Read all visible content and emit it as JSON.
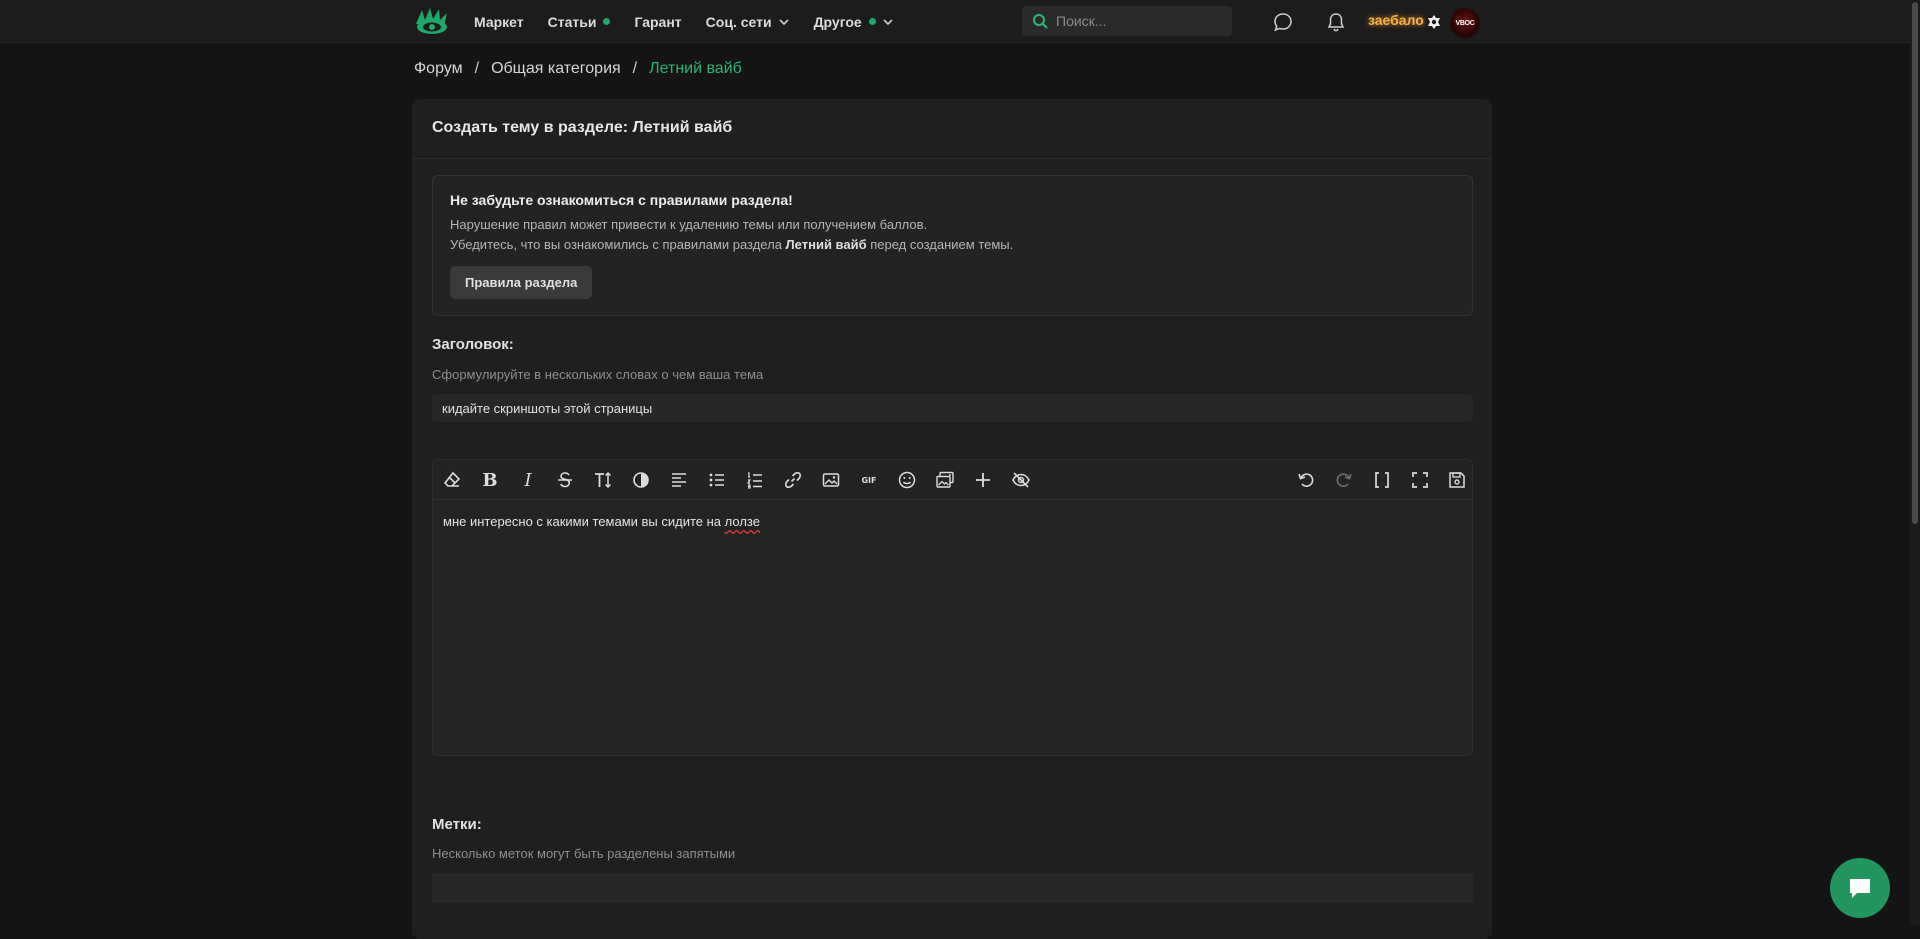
{
  "nav": {
    "items": [
      {
        "label": "Маркет",
        "dot": false,
        "chevron": false
      },
      {
        "label": "Статьи",
        "dot": true,
        "chevron": false
      },
      {
        "label": "Гарант",
        "dot": false,
        "chevron": false
      },
      {
        "label": "Соц. сети",
        "dot": false,
        "chevron": true
      },
      {
        "label": "Другое",
        "dot": true,
        "chevron": true
      }
    ],
    "search_placeholder": "Поиск...",
    "user": {
      "nickname": "заебало",
      "avatar_text": "VBOC"
    }
  },
  "breadcrumb": {
    "items": [
      "Форум",
      "Общая категория",
      "Летний вайб"
    ],
    "separator": "/"
  },
  "panel": {
    "title": "Создать тему в разделе: Летний вайб",
    "notice": {
      "title": "Не забудьте ознакомиться с правилами раздела!",
      "line1": "Нарушение правил может привести к удалению темы или получением баллов.",
      "line2_prefix": "Убедитесь, что вы ознакомились с правилами раздела ",
      "line2_bold": "Летний вайб",
      "line2_suffix": " перед созданием темы.",
      "button": "Правила раздела"
    },
    "title_field": {
      "label": "Заголовок:",
      "hint": "Сформулируйте в нескольких словах о чем ваша тема",
      "value": "кидайте скриншоты этой страницы"
    },
    "editor": {
      "text_before": "мне интересно с какими темами вы сидите на ",
      "text_misspelled": "лолзе",
      "toolbar_left": [
        "eraser-icon",
        "bold-icon",
        "italic-icon",
        "strikethrough-icon",
        "text-size-icon",
        "color-icon",
        "align-icon",
        "bullet-list-icon",
        "numbered-list-icon",
        "link-icon",
        "image-icon",
        "gif-icon",
        "smile-icon",
        "gallery-icon",
        "plus-icon",
        "hide-icon"
      ],
      "toolbar_right": [
        "undo-icon",
        "redo-icon",
        "brackets-icon",
        "fullscreen-icon",
        "save-draft-icon"
      ],
      "gif_label": "GIF"
    },
    "tags_field": {
      "label": "Метки:",
      "hint": "Несколько меток могут быть разделены запятыми"
    }
  },
  "colors": {
    "accent": "#2bb673",
    "background": "#141414",
    "panel": "#1f1f1f",
    "chat_button": "#22965e"
  }
}
